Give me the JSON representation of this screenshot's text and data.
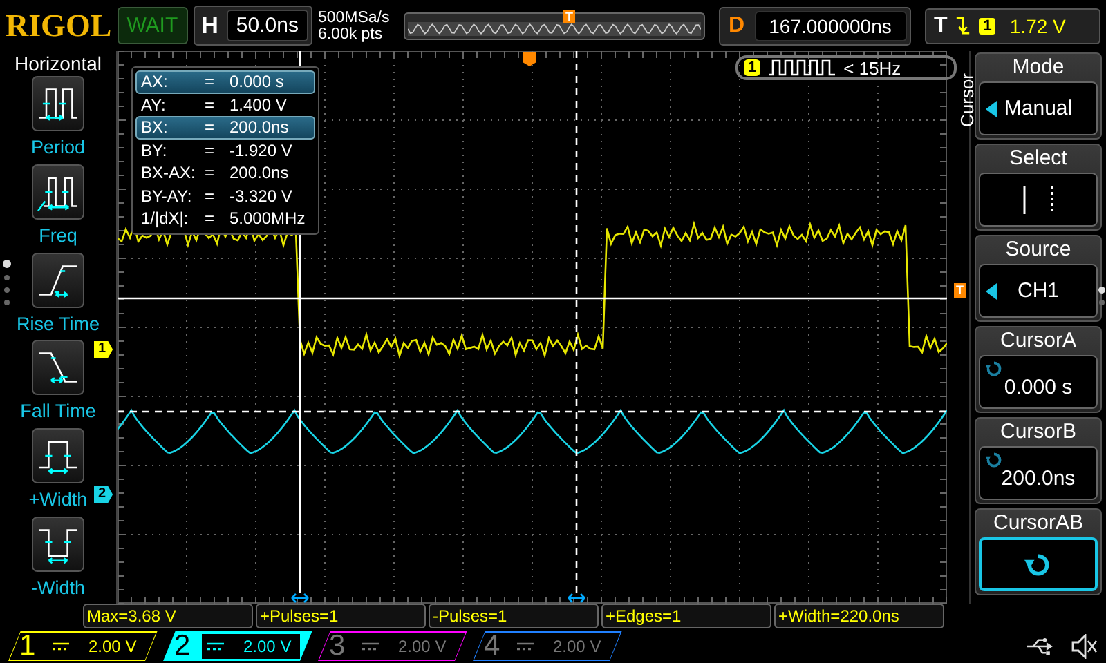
{
  "brand": "RIGOL",
  "run_status": "WAIT",
  "timebase": {
    "label": "H",
    "value": "50.0ns"
  },
  "acquisition": {
    "sample_rate": "500MSa/s",
    "memory_depth": "6.00k pts"
  },
  "trigger_position": {
    "label": "T"
  },
  "delay": {
    "label": "D",
    "value": "167.000000ns"
  },
  "trigger": {
    "label": "T",
    "source": "1",
    "level": "1.72 V"
  },
  "left_menu": {
    "title": "Horizontal",
    "items": [
      {
        "label": "Period",
        "kind": "period"
      },
      {
        "label": "Freq",
        "kind": "freq"
      },
      {
        "label": "Rise Time",
        "kind": "rise"
      },
      {
        "label": "Fall Time",
        "kind": "fall"
      },
      {
        "label": "+Width",
        "kind": "pwidth"
      },
      {
        "label": "-Width",
        "kind": "nwidth"
      }
    ]
  },
  "cursor_readout": [
    {
      "label": "AX:",
      "eq": "=",
      "value": "0.000 s",
      "selected": true
    },
    {
      "label": "AY:",
      "eq": "=",
      "value": "1.400 V",
      "selected": false
    },
    {
      "label": "BX:",
      "eq": "=",
      "value": "200.0ns",
      "selected": true
    },
    {
      "label": "BY:",
      "eq": "=",
      "value": "-1.920 V",
      "selected": false
    },
    {
      "label": "BX-AX:",
      "eq": "=",
      "value": "200.0ns",
      "selected": false
    },
    {
      "label": "BY-AY:",
      "eq": "=",
      "value": "-3.320 V",
      "selected": false
    },
    {
      "label": "1/|dX|:",
      "eq": "=",
      "value": "5.000MHz",
      "selected": false
    }
  ],
  "counter": {
    "channel": "1",
    "value": "< 15Hz"
  },
  "waveform_markers": {
    "ch1": "1",
    "ch2": "2",
    "trigger": "T"
  },
  "right_menu": {
    "title": "Cursor",
    "items": [
      {
        "label": "Mode",
        "kind": "choice",
        "value": "Manual",
        "selected": false
      },
      {
        "label": "Select",
        "kind": "select",
        "selected": false
      },
      {
        "label": "Source",
        "kind": "choice",
        "value": "CH1",
        "selected": false
      },
      {
        "label": "CursorA",
        "kind": "knob_value",
        "value": "0.000 s",
        "selected": false
      },
      {
        "label": "CursorB",
        "kind": "knob_value",
        "value": "200.0ns",
        "selected": false
      },
      {
        "label": "CursorAB",
        "kind": "knob",
        "selected": true
      }
    ]
  },
  "measurements": [
    "Max=3.68 V",
    "+Pulses=1",
    "-Pulses=1",
    "+Edges=1",
    "+Width=220.0ns"
  ],
  "channels": [
    {
      "label": "1",
      "value": "2.00 V",
      "color": "#ffff00",
      "on": true,
      "selected": false
    },
    {
      "label": "2",
      "value": "2.00 V",
      "color": "#00ffff",
      "on": true,
      "selected": true
    },
    {
      "label": "3",
      "value": "2.00 V",
      "color": "#ff00ff",
      "on": false,
      "selected": false
    },
    {
      "label": "4",
      "value": "2.00 V",
      "color": "#2080ff",
      "on": false,
      "selected": false
    }
  ]
}
